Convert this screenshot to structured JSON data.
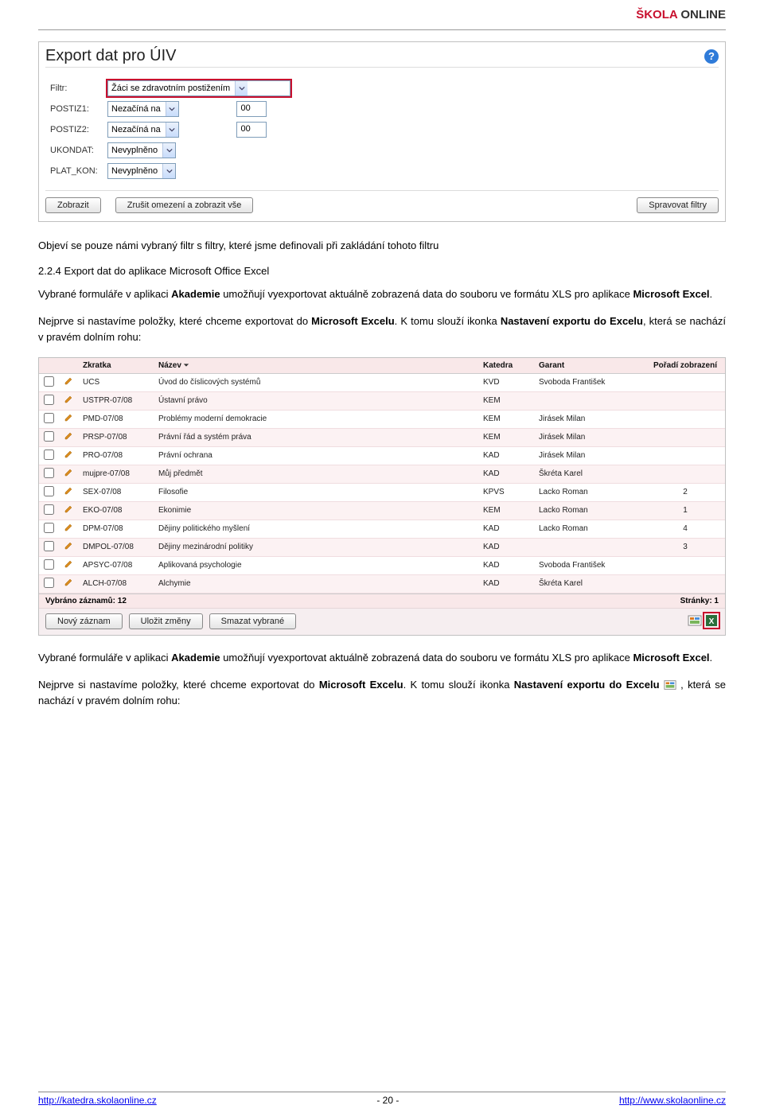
{
  "brand": {
    "red": "ŠKOLA",
    "dark": " ONLINE"
  },
  "shot1": {
    "title": "Export dat pro ÚIV",
    "filter_label": "Filtr:",
    "filter_value": "Žáci se zdravotním postižením",
    "rows": [
      {
        "label": "POSTIZ1:",
        "op": "Nezačíná na",
        "val": "00"
      },
      {
        "label": "POSTIZ2:",
        "op": "Nezačíná na",
        "val": "00"
      },
      {
        "label": "UKONDAT:",
        "op": "Nevyplněno",
        "val": ""
      },
      {
        "label": "PLAT_KON:",
        "op": "Nevyplněno",
        "val": ""
      }
    ],
    "btn_show": "Zobrazit",
    "btn_reset": "Zrušit omezení a zobrazit vše",
    "btn_manage": "Spravovat filtry"
  },
  "para1": "Objeví se pouze námi vybraný filtr s filtry, které jsme definovali při zakládání tohoto filtru",
  "section": "2.2.4 Export dat do aplikace Microsoft Office Excel",
  "para2a": "Vybrané formuláře v aplikaci ",
  "para2b_bold": "Akademie",
  "para2c": " umožňují vyexportovat aktuálně zobrazená data do souboru ve formátu XLS pro aplikace ",
  "para2d_bold": "Microsoft Excel",
  "para2e": ".",
  "para3a": "Nejprve si nastavíme položky, které chceme exportovat do ",
  "para3b_bold": "Microsoft Excelu",
  "para3c": ". K tomu slouží ikonka ",
  "para3d_bold": "Nastavení exportu do Excelu",
  "para3e": ", která se nachází v pravém dolním rohu:",
  "grid": {
    "headers": {
      "zkratka": "Zkratka",
      "nazev": "Název",
      "katedra": "Katedra",
      "garant": "Garant",
      "poradi": "Pořadí zobrazení"
    },
    "rows": [
      {
        "z": "UCS",
        "n": "Úvod do číslicových systémů",
        "k": "KVD",
        "g": "Svoboda František",
        "p": ""
      },
      {
        "z": "USTPR-07/08",
        "n": "Ústavní právo",
        "k": "KEM",
        "g": "",
        "p": ""
      },
      {
        "z": "PMD-07/08",
        "n": "Problémy moderní demokracie",
        "k": "KEM",
        "g": "Jirásek Milan",
        "p": ""
      },
      {
        "z": "PRSP-07/08",
        "n": "Právní řád a systém práva",
        "k": "KEM",
        "g": "Jirásek Milan",
        "p": ""
      },
      {
        "z": "PRO-07/08",
        "n": "Právní ochrana",
        "k": "KAD",
        "g": "Jirásek Milan",
        "p": ""
      },
      {
        "z": "mujpre-07/08",
        "n": "Můj předmět",
        "k": "KAD",
        "g": "Škréta Karel",
        "p": ""
      },
      {
        "z": "SEX-07/08",
        "n": "Filosofie",
        "k": "KPVS",
        "g": "Lacko Roman",
        "p": "2"
      },
      {
        "z": "EKO-07/08",
        "n": "Ekonimie",
        "k": "KEM",
        "g": "Lacko Roman",
        "p": "1"
      },
      {
        "z": "DPM-07/08",
        "n": "Dějiny politického myšlení",
        "k": "KAD",
        "g": "Lacko Roman",
        "p": "4"
      },
      {
        "z": "DMPOL-07/08",
        "n": "Dějiny mezinárodní politiky",
        "k": "KAD",
        "g": "",
        "p": "3"
      },
      {
        "z": "APSYC-07/08",
        "n": "Aplikovaná psychologie",
        "k": "KAD",
        "g": "Svoboda František",
        "p": ""
      },
      {
        "z": "ALCH-07/08",
        "n": "Alchymie",
        "k": "KAD",
        "g": "Škréta Karel",
        "p": ""
      }
    ],
    "footer_left": "Vybráno záznamů: 12",
    "footer_right": "Stránky: 1",
    "btn_new": "Nový záznam",
    "btn_save": "Uložit změny",
    "btn_del": "Smazat vybrané"
  },
  "para4a": "Vybrané formuláře v aplikaci ",
  "para4b_bold": "Akademie",
  "para4c": " umožňují vyexportovat aktuálně zobrazená data do souboru ve formátu XLS pro aplikace ",
  "para4d_bold": "Microsoft Excel",
  "para4e": ".",
  "para5a": "Nejprve si nastavíme položky, které chceme exportovat do ",
  "para5b_bold": "Microsoft Excelu",
  "para5c": ". K tomu slouží ikonka ",
  "para5d_bold": "Nastavení exportu do Excelu",
  "para5e": " ",
  "para5f": ", která se nachází v pravém dolním rohu:",
  "footer": {
    "left": "http://katedra.skolaonline.cz",
    "center": "- 20 -",
    "right": "http://www.skolaonline.cz"
  }
}
